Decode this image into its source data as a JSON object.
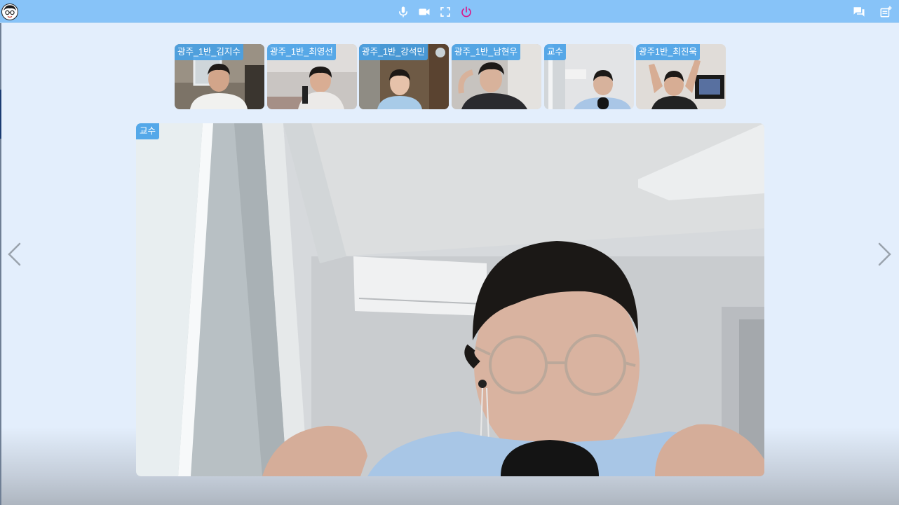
{
  "toolbar": {
    "logo_icon": "avatar-logo",
    "controls": [
      "mic-icon",
      "camera-icon",
      "fullscreen-icon",
      "power-icon"
    ],
    "right_controls": [
      "chat-icon",
      "add-note-icon"
    ],
    "background_color": "#87c3f8",
    "power_color": "#d81b8a"
  },
  "participants": [
    {
      "name": "광주_1반_김지수"
    },
    {
      "name": "광주_1반_최영선"
    },
    {
      "name": "광주_1반_강석민"
    },
    {
      "name": "광주_1반_남현우"
    },
    {
      "name": "교수"
    },
    {
      "name": "광주1반_최진욱"
    }
  ],
  "main_video": {
    "speaker": "교수"
  },
  "navigation": {
    "prev_icon": "chevron-left-icon",
    "next_icon": "chevron-right-icon"
  },
  "colors": {
    "name_tag": "#44a0e8",
    "page_background": "#e3eefc"
  }
}
